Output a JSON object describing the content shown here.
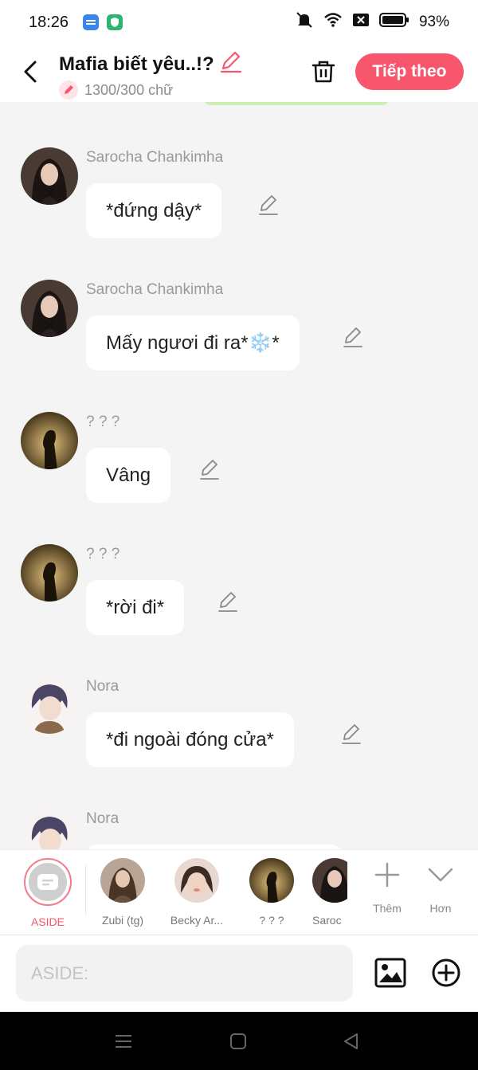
{
  "status": {
    "time": "18:26",
    "app_icon_1": "noveltoon-icon",
    "app_icon_2": "shield-icon",
    "battery": "93%"
  },
  "header": {
    "title": "Mafia biết yêu..!?",
    "char_count": "1300/300 chữ",
    "next_label": "Tiếp theo",
    "accent_color": "#f8566d"
  },
  "messages": [
    {
      "name": "Sarocha Chankimha",
      "text": "*đứng dậy*",
      "avatar": "woman-dark-hair"
    },
    {
      "name": "Sarocha Chankimha",
      "text": "Mấy ngươi đi ra*❄️*",
      "avatar": "woman-dark-hair"
    },
    {
      "name": "? ? ?",
      "text": "Vâng",
      "avatar": "silhouette-gold"
    },
    {
      "name": "? ? ?",
      "text": "*rời đi*",
      "avatar": "silhouette-gold"
    },
    {
      "name": "Nora",
      "text": "*đi ngoài đóng cửa*",
      "avatar": "anime-boy-purple-hair"
    },
    {
      "name": "Nora",
      "text": "",
      "avatar": "anime-boy-purple-hair"
    }
  ],
  "characters": [
    {
      "label": "ASIDE"
    },
    {
      "label": "Zubi (tg)"
    },
    {
      "label": "Becky Ar..."
    },
    {
      "label": "? ? ?"
    },
    {
      "label": "Saroc"
    }
  ],
  "tools": {
    "add_label": "Thêm",
    "more_label": "Hơn"
  },
  "input": {
    "placeholder": "ASIDE:"
  }
}
